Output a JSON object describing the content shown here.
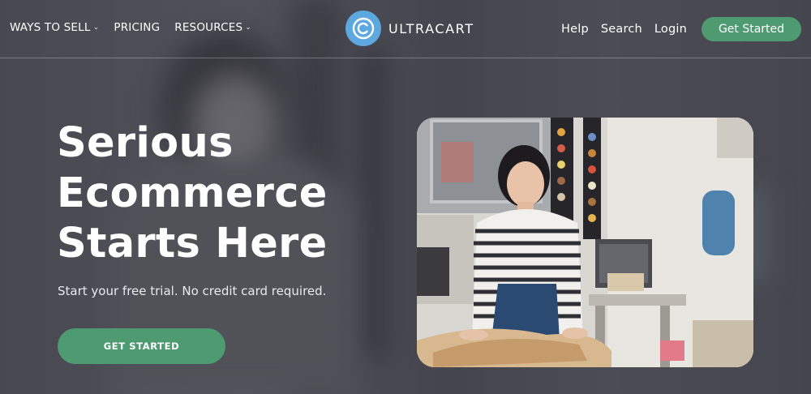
{
  "nav": {
    "left_items": [
      {
        "label": "WAYS TO SELL",
        "has_caret": true
      },
      {
        "label": "PRICING",
        "has_caret": false
      },
      {
        "label": "RESOURCES",
        "has_caret": true
      }
    ],
    "brand": {
      "name": "ULTRACART",
      "logo_icon": "ultracart-c-logo-icon"
    },
    "right_items": [
      "Help",
      "Search",
      "Login"
    ],
    "cta_label": "Get Started"
  },
  "hero": {
    "headline_lines": [
      "Serious",
      "Ecommerce",
      "Starts Here"
    ],
    "subtext": "Start your free trial. No credit card required.",
    "cta_label": "GET STARTED"
  },
  "colors": {
    "accent_green": "#4e9a71",
    "logo_blue": "#5ea8e0",
    "background": "#54545d"
  },
  "caret_glyph": "⌄"
}
